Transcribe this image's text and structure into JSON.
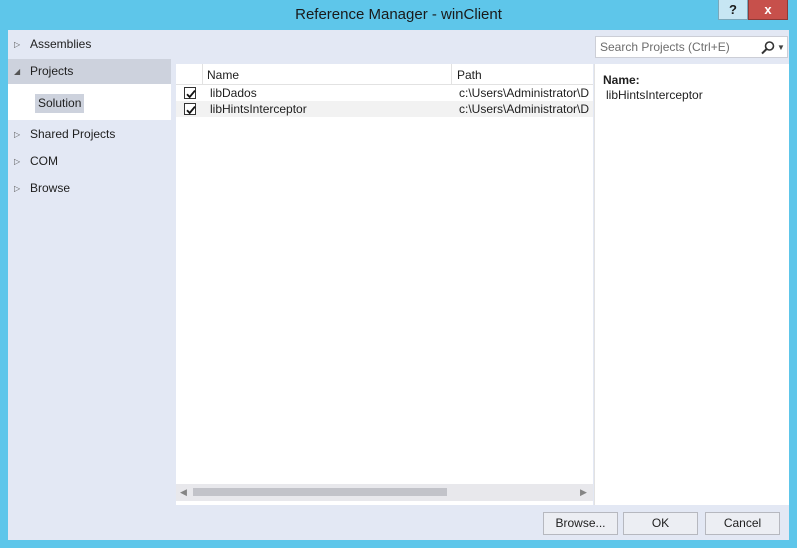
{
  "window": {
    "title": "Reference Manager - winClient",
    "help_label": "?",
    "close_label": "x"
  },
  "sidebar": {
    "items": [
      {
        "label": "Assemblies",
        "expanded": false
      },
      {
        "label": "Projects",
        "expanded": true
      },
      {
        "label": "Shared Projects",
        "expanded": false
      },
      {
        "label": "COM",
        "expanded": false
      },
      {
        "label": "Browse",
        "expanded": false
      }
    ],
    "sub_items": [
      {
        "label": "Solution"
      }
    ]
  },
  "search": {
    "placeholder": "Search Projects (Ctrl+E)",
    "icon": "search-icon"
  },
  "list": {
    "columns": [
      "Name",
      "Path"
    ],
    "rows": [
      {
        "checked": true,
        "name": "libDados",
        "path": "c:\\Users\\Administrator\\D"
      },
      {
        "checked": true,
        "name": "libHintsInterceptor",
        "path": "c:\\Users\\Administrator\\D"
      }
    ]
  },
  "details": {
    "name_label": "Name:",
    "name_value": "libHintsInterceptor"
  },
  "buttons": {
    "browse": "Browse...",
    "ok": "OK",
    "cancel": "Cancel"
  },
  "colors": {
    "titlebar": "#5ec6ea",
    "panel": "#e3e8f4",
    "selected": "#cdd2dd",
    "close": "#c7504b"
  }
}
